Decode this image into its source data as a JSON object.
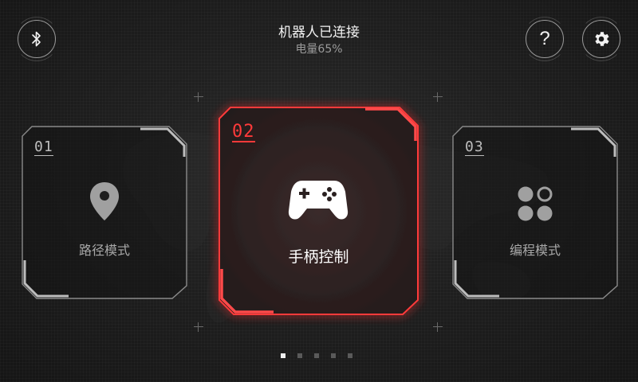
{
  "status": {
    "connection": "机器人已连接",
    "battery": "电量65%"
  },
  "header": {
    "left_button_icon": "bluetooth-icon",
    "help_icon": "help-icon",
    "help_glyph": "?",
    "settings_icon": "gear-icon"
  },
  "cards": [
    {
      "number": "01",
      "label": "路径模式",
      "icon": "location-pin-icon",
      "active": false
    },
    {
      "number": "02",
      "label": "手柄控制",
      "icon": "gamepad-icon",
      "active": true
    },
    {
      "number": "03",
      "label": "编程模式",
      "icon": "grid-dots-icon",
      "active": false
    }
  ],
  "pager": {
    "count": 5,
    "active_index": 0
  },
  "colors": {
    "accent": "#ff3a3a",
    "background": "#1b1b1b",
    "text_primary": "#f2f2f2",
    "text_secondary": "#9a9a9a"
  }
}
